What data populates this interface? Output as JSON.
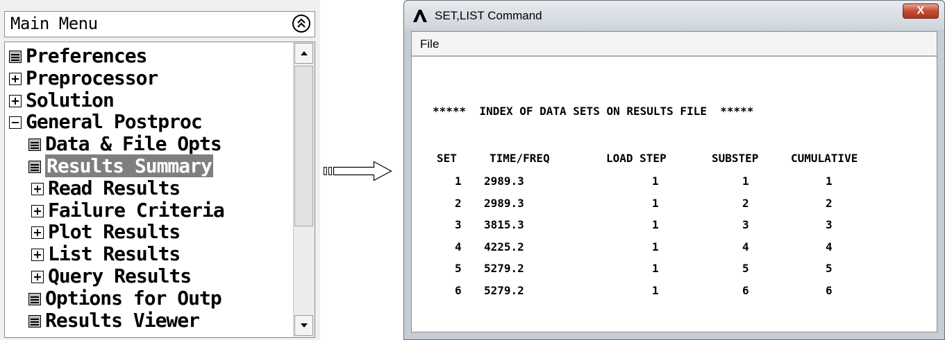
{
  "main_menu": {
    "title": "Main Menu",
    "collapse_icon": "double-chevron-up-icon",
    "items": [
      {
        "label": "Preferences",
        "icon": "calculator-doc-icon"
      },
      {
        "label": "Preprocessor",
        "icon": "expand-plus-icon"
      },
      {
        "label": "Solution",
        "icon": "expand-plus-icon"
      },
      {
        "label": "General Postproc",
        "icon": "collapse-minus-icon"
      },
      {
        "label": "Data & File Opts",
        "icon": "calculator-doc-icon"
      },
      {
        "label": "Results Summary",
        "icon": "calculator-doc-icon",
        "selected": true
      },
      {
        "label": "Read Results",
        "icon": "expand-plus-icon"
      },
      {
        "label": "Failure Criteria",
        "icon": "expand-plus-icon"
      },
      {
        "label": "Plot Results",
        "icon": "expand-plus-icon"
      },
      {
        "label": "List Results",
        "icon": "expand-plus-icon"
      },
      {
        "label": "Query Results",
        "icon": "expand-plus-icon"
      },
      {
        "label": "Options for Outp",
        "icon": "calculator-doc-icon"
      },
      {
        "label": "Results Viewer",
        "icon": "calculator-doc-icon"
      }
    ]
  },
  "window": {
    "title": "SET,LIST Command",
    "close_label": "X",
    "menu": {
      "file": "File"
    }
  },
  "listing": {
    "heading": "*****  INDEX OF DATA SETS ON RESULTS FILE  *****",
    "columns": [
      "SET",
      "TIME/FREQ",
      "LOAD STEP",
      "SUBSTEP",
      "CUMULATIVE"
    ],
    "rows": [
      [
        "1",
        "2989.3",
        "1",
        "1",
        "1"
      ],
      [
        "2",
        "2989.3",
        "1",
        "2",
        "2"
      ],
      [
        "3",
        "3815.3",
        "1",
        "3",
        "3"
      ],
      [
        "4",
        "4225.2",
        "1",
        "4",
        "4"
      ],
      [
        "5",
        "5279.2",
        "1",
        "5",
        "5"
      ],
      [
        "6",
        "5279.2",
        "1",
        "6",
        "6"
      ]
    ]
  },
  "colors": {
    "selection_bg": "#7f7f7f",
    "close_button": "#c44c34"
  }
}
